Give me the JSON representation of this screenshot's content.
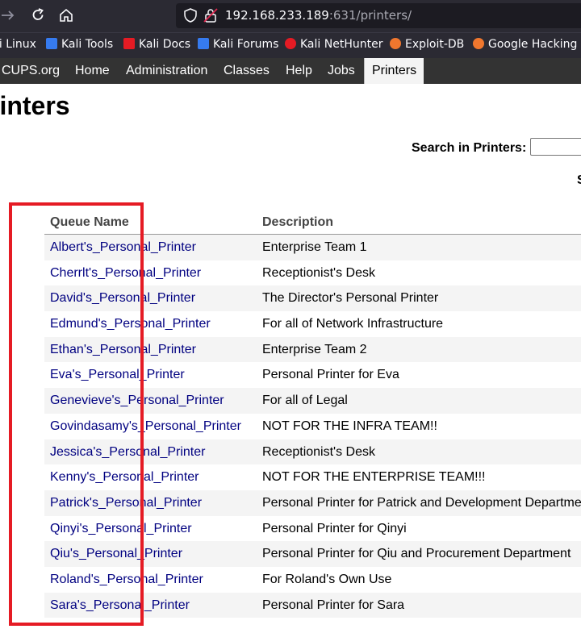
{
  "browser": {
    "url_host": "192.168.233.189",
    "url_rest": ":631/printers/",
    "bookmarks": [
      {
        "label": "li Linux",
        "color": "#367bf0"
      },
      {
        "label": "Kali Tools",
        "color": "#367bf0"
      },
      {
        "label": "Kali Docs",
        "color": "#e51b24"
      },
      {
        "label": "Kali Forums",
        "color": "#367bf0"
      },
      {
        "label": "Kali NetHunter",
        "color": "#e51b24"
      },
      {
        "label": "Exploit-DB",
        "color": "#f0772e"
      },
      {
        "label": "Google Hacking D",
        "color": "#f0772e"
      }
    ]
  },
  "cups_nav": {
    "tabs": [
      {
        "label": "CUPS.org"
      },
      {
        "label": "Home"
      },
      {
        "label": "Administration"
      },
      {
        "label": "Classes"
      },
      {
        "label": "Help"
      },
      {
        "label": "Jobs"
      },
      {
        "label": "Printers",
        "active": true
      }
    ]
  },
  "page": {
    "title": "rinters",
    "search_label": "Search in Printers:",
    "search_value": "",
    "edge_char": "S"
  },
  "table": {
    "headers": [
      "Queue Name",
      "Description"
    ],
    "rows": [
      {
        "name": "Albert's_Personal_Printer",
        "desc": "Enterprise Team 1"
      },
      {
        "name": "Cherrlt's_Personal_Printer",
        "desc": "Receptionist's Desk"
      },
      {
        "name": "David's_Personal_Printer",
        "desc": "The Director's Personal Printer"
      },
      {
        "name": "Edmund's_Personal_Printer",
        "desc": "For all of Network Infrastructure"
      },
      {
        "name": "Ethan's_Personal_Printer",
        "desc": "Enterprise Team 2"
      },
      {
        "name": "Eva's_Personal_Printer",
        "desc": "Personal Printer for Eva"
      },
      {
        "name": "Genevieve's_Personal_Printer",
        "desc": "For all of Legal"
      },
      {
        "name": "Govindasamy's_Personal_Printer",
        "desc": "NOT FOR THE INFRA TEAM!!"
      },
      {
        "name": "Jessica's_Personal_Printer",
        "desc": "Receptionist's Desk"
      },
      {
        "name": "Kenny's_Personal_Printer",
        "desc": "NOT FOR THE ENTERPRISE TEAM!!!"
      },
      {
        "name": "Patrick's_Personal_Printer",
        "desc": "Personal Printer for Patrick and Development Departme"
      },
      {
        "name": "Qinyi's_Personal_Printer",
        "desc": "Personal Printer for Qinyi"
      },
      {
        "name": "Qiu's_Personal_Printer",
        "desc": "Personal Printer for Qiu and Procurement Department"
      },
      {
        "name": "Roland's_Personal_Printer",
        "desc": "For Roland's Own Use"
      },
      {
        "name": "Sara's_Personal_Printer",
        "desc": "Personal Printer for Sara"
      }
    ]
  },
  "annotation": {
    "color": "#e51b24"
  }
}
